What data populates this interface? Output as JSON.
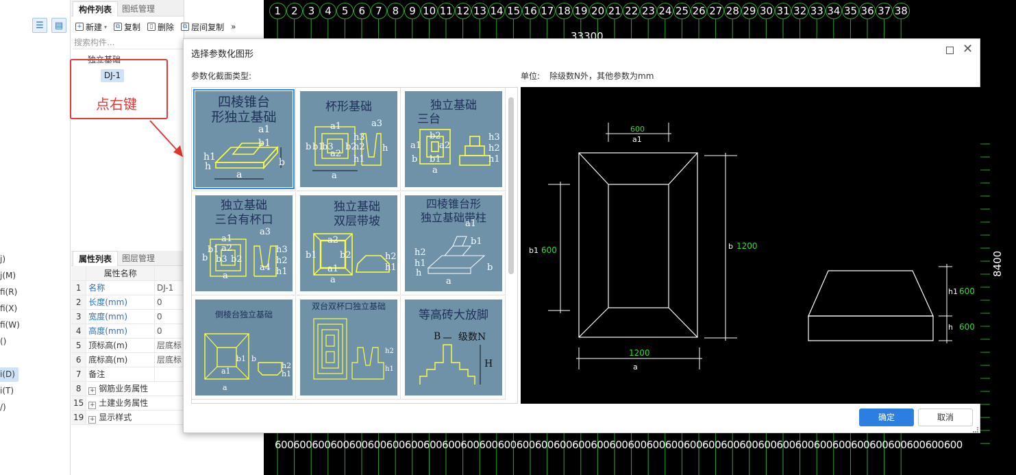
{
  "left_strip": {
    "items": [
      "j)",
      "j(M)",
      "fi(R)",
      "fi(X)",
      "fi(W)",
      "()",
      "i(D)",
      "i(T)",
      "/)"
    ]
  },
  "component_panel": {
    "tabs": [
      "构件列表",
      "图纸管理"
    ],
    "toolbar": {
      "new": "新建",
      "copy": "复制",
      "delete": "删除",
      "floor_copy": "层间复制",
      "more": "»"
    },
    "search_placeholder": "搜索构件...",
    "tree_group": "独立基础",
    "tree_item": "DJ-1"
  },
  "annotation": {
    "label": "点右键"
  },
  "property_panel": {
    "tabs": [
      "属性列表",
      "图层管理"
    ],
    "header_name": "属性名称",
    "rows": [
      {
        "num": "1",
        "name": "名称",
        "value": "DJ-1"
      },
      {
        "num": "2",
        "name": "长度(mm)",
        "value": "0"
      },
      {
        "num": "3",
        "name": "宽度(mm)",
        "value": "0"
      },
      {
        "num": "4",
        "name": "高度(mm)",
        "value": "0"
      },
      {
        "num": "5",
        "name": "顶标高(m)",
        "value": "层底标"
      },
      {
        "num": "6",
        "name": "底标高(m)",
        "value": "层底标"
      },
      {
        "num": "7",
        "name": "备注",
        "value": ""
      },
      {
        "num": "8",
        "name": "钢筋业务属性",
        "value": ""
      },
      {
        "num": "15",
        "name": "土建业务属性",
        "value": ""
      },
      {
        "num": "19",
        "name": "显示样式",
        "value": ""
      }
    ]
  },
  "cad": {
    "axis_numbers": [
      "1",
      "2",
      "3",
      "4",
      "5",
      "6",
      "7",
      "8",
      "9",
      "10",
      "11",
      "12",
      "13",
      "14",
      "15",
      "16",
      "17",
      "18",
      "19",
      "20",
      "21",
      "22",
      "23",
      "24",
      "25",
      "26",
      "27",
      "28",
      "29",
      "30",
      "31",
      "32",
      "33",
      "34",
      "35",
      "36",
      "37",
      "38"
    ],
    "top_dim_fragment": "33300",
    "bottom_dims": "600600600600600600600600600600600600600600600600600600600600600600600600600600600600600600600600600600600600600",
    "side_dim": "8400"
  },
  "dialog": {
    "title": "选择参数化图形",
    "section_label": "参数化截面类型:",
    "unit_label": "单位:",
    "unit_text": "除级数N外，其他参数为mm",
    "shapes": [
      {
        "title": "四棱锥台形独立基础",
        "line1": "四棱锥台",
        "line2": "形独立基础",
        "labels": [
          "a1",
          "b1",
          "h1",
          "h",
          "a",
          "b"
        ]
      },
      {
        "title": "杯形基础",
        "line1": "杯形基础",
        "line2": "",
        "labels": [
          "a1",
          "a2",
          "a3",
          "b",
          "b1",
          "b3",
          "b2",
          "h3",
          "h2",
          "h1",
          "h",
          "a"
        ]
      },
      {
        "title": "独立基础三台",
        "line1": "独立基础",
        "line2": "三台",
        "labels": [
          "b2",
          "a2",
          "a1",
          "b1",
          "h3",
          "h2",
          "h1",
          "a",
          "b"
        ]
      },
      {
        "title": "独立基础三台有杯口",
        "line1": "独立基础",
        "line2": "三台有杯口",
        "labels": [
          "a1",
          "a3",
          "a2",
          "b",
          "b1",
          "b3",
          "b2",
          "h3",
          "h2",
          "h1",
          "a4",
          "a"
        ]
      },
      {
        "title": "独立基础双层带坡",
        "line1": "独立基础",
        "line2": "双层带坡",
        "labels": [
          "a2",
          "b1",
          "b2",
          "a1",
          "h2",
          "h1",
          "a"
        ]
      },
      {
        "title": "四棱锥台形独立基础带柱",
        "line1": "四棱锥台形",
        "line2": "独立基础带柱",
        "labels": [
          "a1",
          "b1",
          "h2",
          "h1",
          "h",
          "b",
          "a"
        ]
      },
      {
        "title": "倒棱台独立基础",
        "line1": "倒棱台独立基础",
        "line2": "",
        "labels": [
          "b1",
          "b",
          "a1",
          "h2",
          "h1",
          "a"
        ]
      },
      {
        "title": "双台双杯口独立基础",
        "line1": "双台双杯口独立基础",
        "line2": "",
        "labels": [
          "h2",
          "h1"
        ]
      },
      {
        "title": "等高砖大放脚",
        "line1": "等高砖大放脚",
        "line2": "",
        "labels": [
          "B",
          "级数N",
          "H"
        ]
      }
    ],
    "preview": {
      "plan_labels": {
        "a1": "a1",
        "a1_value": "600",
        "b1": "b1",
        "b1_value": "600",
        "b": "b",
        "b_value": "1200",
        "a": "a",
        "a_value": "1200"
      },
      "section_labels": {
        "h1": "h1",
        "h1_value": "600",
        "h": "h",
        "h_value": "600"
      },
      "line_color": "#ffffff",
      "value_color": "#33dd33"
    },
    "ok": "确定",
    "cancel": "取消"
  },
  "colors": {
    "accent": "#2c7fe0",
    "thumb_bg": "#6f92a9",
    "highlight": "#ffff44",
    "annotation_red": "#e53935",
    "cad_grid": "#2fa82f"
  }
}
